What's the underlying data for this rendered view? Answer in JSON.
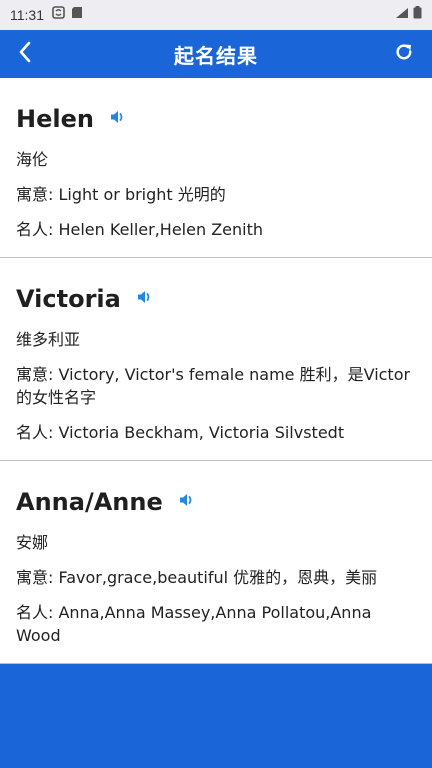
{
  "status_bar": {
    "time": "11:31"
  },
  "app_bar": {
    "title": "起名结果",
    "back_icon": "chevron-left-icon",
    "refresh_icon": "refresh-icon"
  },
  "colors": {
    "primary": "#1a66d9",
    "speaker": "#1f88e5"
  },
  "results": [
    {
      "name": "Helen",
      "chinese": "海伦",
      "meaning": "寓意: Light or bright  光明的",
      "famous": "名人: Helen Keller,Helen Zenith"
    },
    {
      "name": "Victoria",
      "chinese": "维多利亚",
      "meaning": "寓意: Victory, Victor's female name  胜利，是Victor的女性名字",
      "famous": "名人: Victoria Beckham, Victoria Silvstedt"
    },
    {
      "name": "Anna/Anne",
      "chinese": "安娜",
      "meaning": "寓意: Favor,grace,beautiful  优雅的，恩典，美丽",
      "famous": "名人: Anna,Anna Massey,Anna Pollatou,Anna Wood"
    }
  ]
}
